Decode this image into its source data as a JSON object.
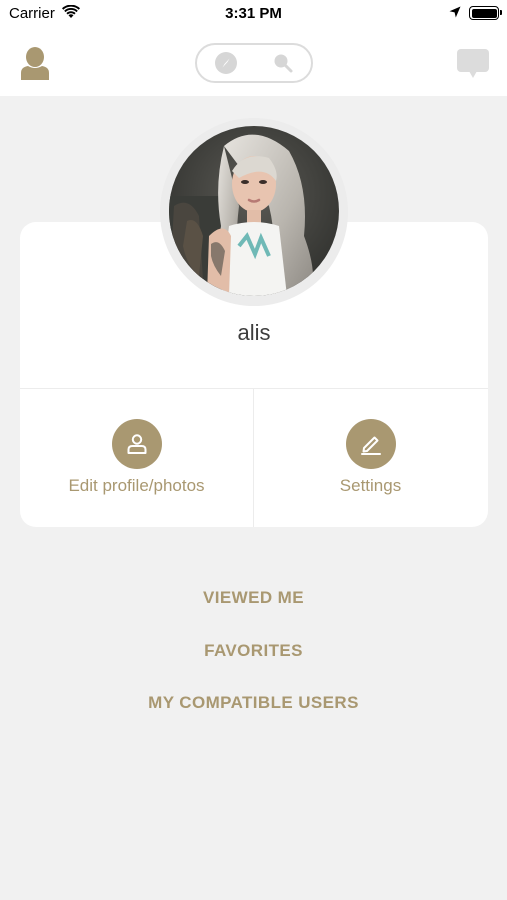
{
  "status_bar": {
    "carrier": "Carrier",
    "time": "3:31 PM"
  },
  "nav": {
    "left_icon": "profile-icon",
    "segments": [
      "compass-icon",
      "search-icon"
    ],
    "right_icon": "chat-icon"
  },
  "profile": {
    "name": "alis",
    "avatar": "user-photo"
  },
  "actions": {
    "edit_label": "Edit profile/photos",
    "edit_icon": "person-icon",
    "settings_label": "Settings",
    "settings_icon": "pencil-icon"
  },
  "links": {
    "viewed_me": "VIEWED ME",
    "favorites": "FAVORITES",
    "compatible": "MY COMPATIBLE USERS"
  },
  "colors": {
    "accent": "#a99871",
    "background": "#f1f1f1",
    "card": "#ffffff"
  }
}
